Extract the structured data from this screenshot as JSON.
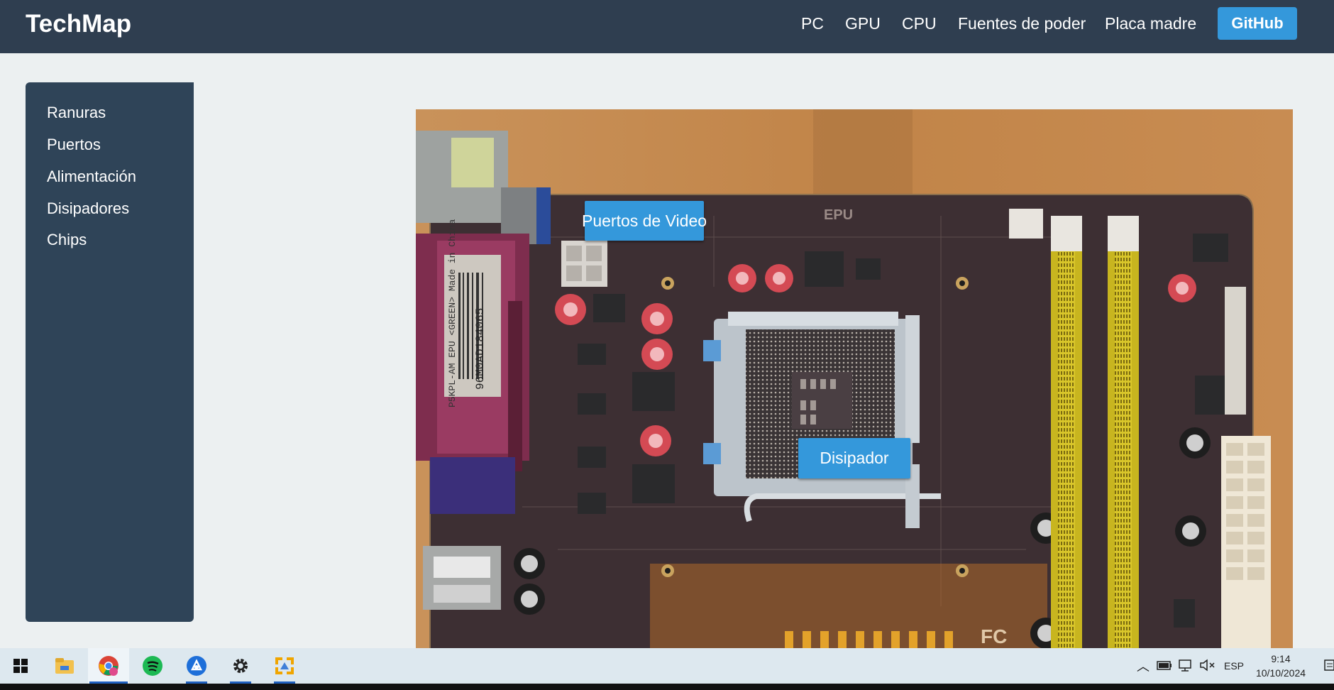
{
  "header": {
    "brand": "TechMap",
    "nav": [
      "PC",
      "GPU",
      "CPU",
      "Fuentes de poder",
      "Placa madre"
    ],
    "github_label": "GitHub"
  },
  "sidebar": {
    "items": [
      "Ranuras",
      "Puertos",
      "Alimentación",
      "Disipadores",
      "Chips"
    ]
  },
  "main": {
    "image_alt": "Placa madre",
    "hotspots": {
      "video_ports": "Puertos de Video",
      "heatsink": "Disipador"
    },
    "board_print": {
      "epu": "EPU",
      "sticker_line1": "P5KPL-AM EPU <GREEN> Made in China",
      "sticker_line2": "96M0AD184065"
    }
  },
  "taskbar": {
    "apps": [
      "start-icon",
      "file-explorer-icon",
      "chrome-icon",
      "spotify-icon",
      "app-icon",
      "settings-icon",
      "app2-icon"
    ],
    "language": "ESP",
    "time": "9:14",
    "date": "10/10/2024"
  },
  "colors": {
    "header": "#2f3e50",
    "sidebar": "#2f4458",
    "accent": "#3498db",
    "background": "#ecf0f1"
  }
}
